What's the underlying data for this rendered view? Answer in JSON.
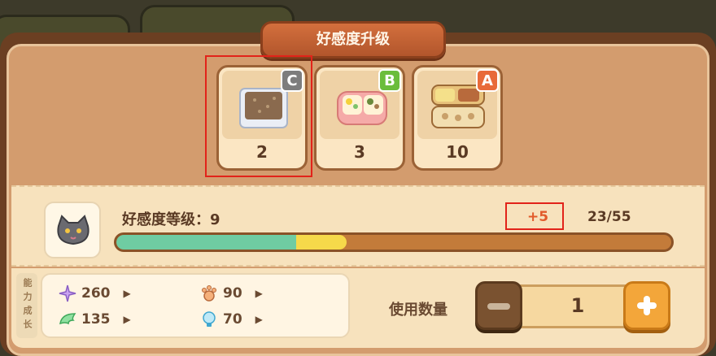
{
  "title": "好感度升级",
  "items": [
    {
      "grade": "C",
      "count": "2",
      "icon": "plain-rice-box-icon"
    },
    {
      "grade": "B",
      "count": "3",
      "icon": "pink-bento-icon"
    },
    {
      "grade": "A",
      "count": "10",
      "icon": "deluxe-bento-icon"
    }
  ],
  "favor": {
    "level_label": "好感度等级：9",
    "gain": "+5",
    "progress_text": "23/55",
    "current_fraction": 0.3236,
    "preview_fraction": 0.4146
  },
  "ability": {
    "label": "能力成长",
    "stats": [
      {
        "value": "260",
        "icon": "purple-star-icon"
      },
      {
        "value": "90",
        "icon": "paw-icon"
      },
      {
        "value": "135",
        "icon": "green-wing-icon"
      },
      {
        "value": "70",
        "icon": "lightbulb-icon"
      }
    ]
  },
  "use": {
    "label": "使用数量",
    "quantity": "1"
  },
  "colors": {
    "progress_green": "#6fcca2",
    "progress_yellow": "#f6d94a",
    "accent_orange": "#f3a63a"
  }
}
